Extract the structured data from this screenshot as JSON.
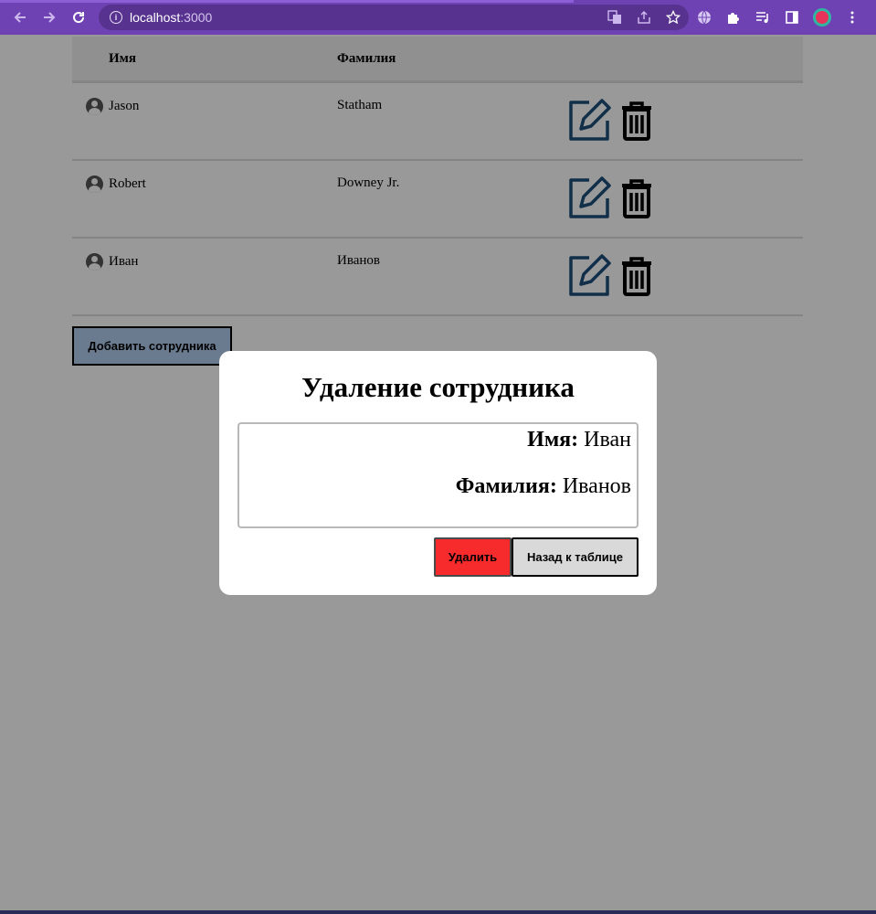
{
  "browser": {
    "url_host": "localhost",
    "url_port": ":3000"
  },
  "table": {
    "headers": {
      "name": "Имя",
      "surname": "Фамилия"
    },
    "rows": [
      {
        "name": "Jason",
        "surname": "Statham"
      },
      {
        "name": "Robert",
        "surname": "Downey Jr."
      },
      {
        "name": "Иван",
        "surname": "Иванов"
      }
    ]
  },
  "add_button_label": "Добавить сотрудника",
  "modal": {
    "title": "Удаление сотрудника",
    "name_label": "Имя:",
    "name_value": "Иван",
    "surname_label": "Фамилия:",
    "surname_value": "Иванов",
    "delete_label": "Удалить",
    "back_label": "Назад к таблице"
  },
  "colors": {
    "browser_bar": "#6f42b4",
    "add_button": "#b1ccee",
    "delete_button": "#f72b2b",
    "back_button": "#d9d9d9"
  },
  "icons": [
    "back-arrow-icon",
    "forward-arrow-icon",
    "reload-icon",
    "info-icon",
    "translate-icon",
    "share-icon",
    "star-icon",
    "globe-icon",
    "puzzle-icon",
    "media-icon",
    "sidepanel-icon",
    "menu-dots-icon",
    "user-avatar-icon",
    "edit-icon",
    "trash-icon"
  ]
}
